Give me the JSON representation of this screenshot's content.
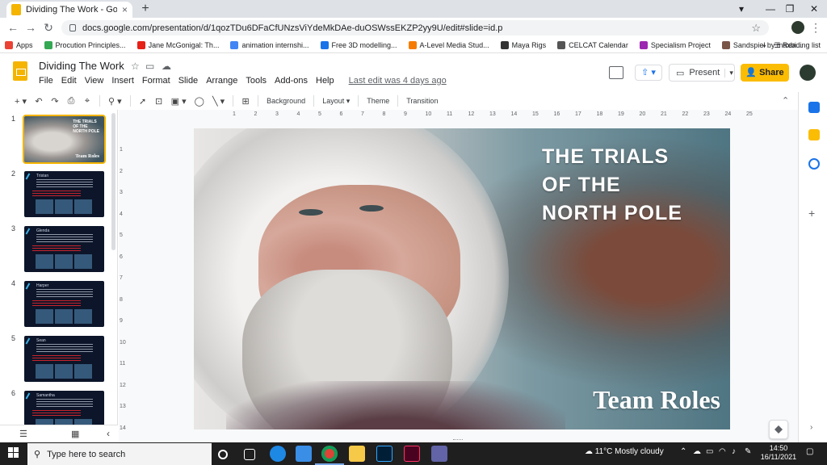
{
  "browser": {
    "tab_title": "Dividing The Work - Google Slides",
    "tab_close": "×",
    "new_tab": "+",
    "url": "docs.google.com/presentation/d/1qozTDu6DFaCfUNzsViYdeMkDAe-duOSWssEKZP2yy9U/edit#slide=id.p",
    "back": "←",
    "forward": "→",
    "reload": "↻",
    "star": "☆",
    "menu": "⋮",
    "win_min": "—",
    "win_max": "❐",
    "win_close": "✕"
  },
  "bookmarks": [
    {
      "label": "Apps",
      "color": "#ea4335"
    },
    {
      "label": "Procution Principles...",
      "color": "#34a853"
    },
    {
      "label": "Jane McGonigal: Th...",
      "color": "#e62117"
    },
    {
      "label": "animation internshi...",
      "color": "#4285f4"
    },
    {
      "label": "Free 3D modelling...",
      "color": "#1a73e8"
    },
    {
      "label": "A-Level Media Stud...",
      "color": "#f57c00"
    },
    {
      "label": "Maya Rigs",
      "color": "#333333"
    },
    {
      "label": "CELCAT Calendar",
      "color": "#555555"
    },
    {
      "label": "Specialism Project",
      "color": "#9c27b0"
    },
    {
      "label": "Sandspiel by maxbi...",
      "color": "#795548"
    }
  ],
  "bookmarks_more": "»",
  "reading_list": "Reading list",
  "doc": {
    "title": "Dividing The Work",
    "menus": [
      "File",
      "Edit",
      "View",
      "Insert",
      "Format",
      "Slide",
      "Arrange",
      "Tools",
      "Add-ons",
      "Help"
    ],
    "last_edit": "Last edit was 4 days ago",
    "present_label": "Present",
    "share_label": "Share",
    "upload_label": "⇧ ▾"
  },
  "toolbar": {
    "background": "Background",
    "layout": "Layout ▾",
    "theme": "Theme",
    "transition": "Transition",
    "collapse": "⌃"
  },
  "ruler_marks": [
    "1",
    "2",
    "3",
    "4",
    "5",
    "6",
    "7",
    "8",
    "9",
    "10",
    "11",
    "12",
    "13",
    "14",
    "15",
    "16",
    "17",
    "18",
    "19",
    "20",
    "21",
    "22",
    "23",
    "24",
    "25"
  ],
  "ruler_v_marks": [
    "1",
    "2",
    "3",
    "4",
    "5",
    "6",
    "7",
    "8",
    "9",
    "10",
    "11",
    "12",
    "13",
    "14"
  ],
  "slides": [
    {
      "num": "1",
      "name": "",
      "type": "title"
    },
    {
      "num": "2",
      "name": "Tristan",
      "type": "content"
    },
    {
      "num": "3",
      "name": "Glenda",
      "type": "content"
    },
    {
      "num": "4",
      "name": "Harper",
      "type": "content"
    },
    {
      "num": "5",
      "name": "Sean",
      "type": "content"
    },
    {
      "num": "6",
      "name": "Samantha",
      "type": "content"
    }
  ],
  "slide": {
    "title": "THE TRIALS\nOF THE\nNORTH POLE",
    "subtitle": "Team Roles",
    "thumb_title": "THE TRIALS\nOF THE\nNORTH POLE"
  },
  "taskbar": {
    "search_placeholder": "Type here to search",
    "weather": "11°C  Mostly cloudy",
    "time": "14:50",
    "date": "16/11/2021"
  },
  "colors": {
    "accent_yellow": "#fbbc04",
    "slides_brand": "#f4b400",
    "link_blue": "#1a73e8"
  }
}
